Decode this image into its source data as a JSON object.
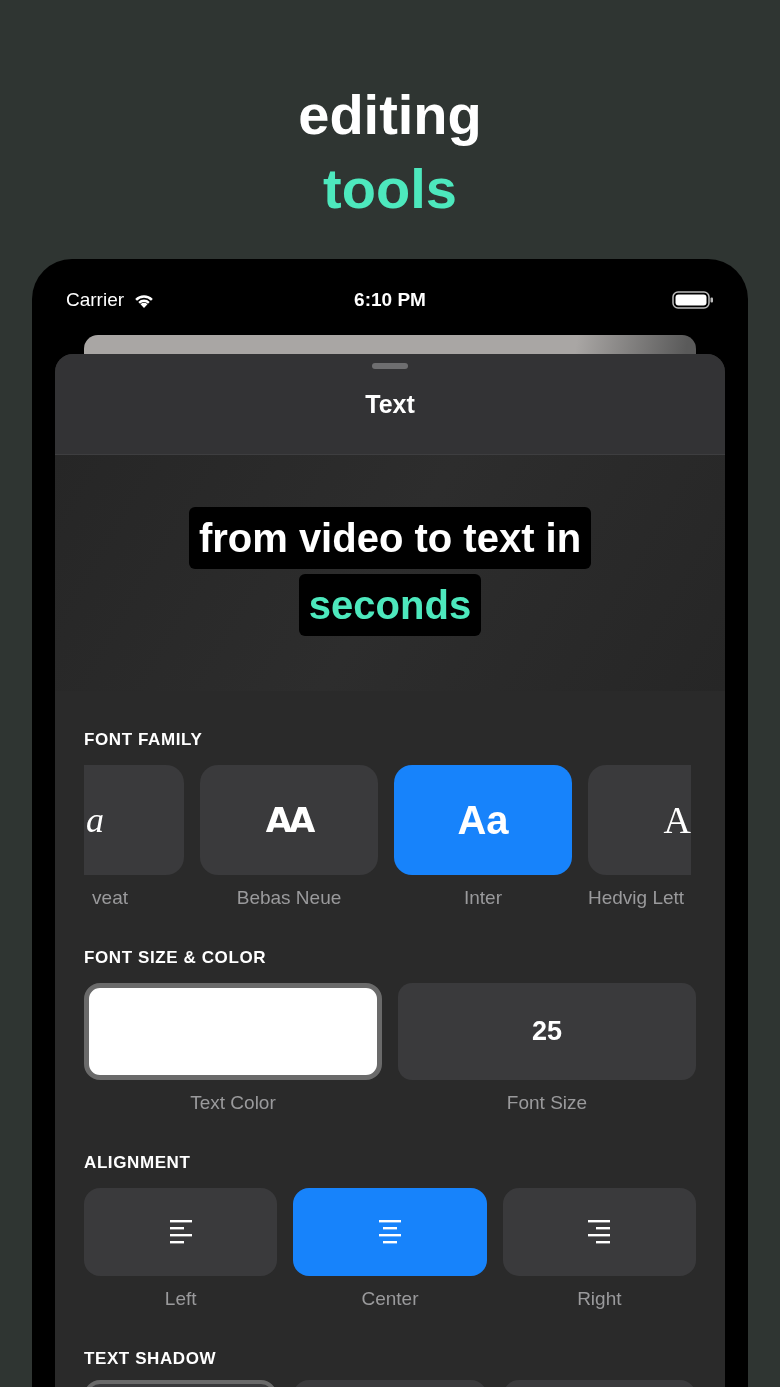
{
  "headline": {
    "line_1": "editing",
    "line_2": "tools"
  },
  "status_bar": {
    "carrier": "Carrier",
    "time": "6:10 PM"
  },
  "sheet": {
    "title": "Text"
  },
  "preview": {
    "lines": [
      {
        "text": "from video to text in",
        "highlighted": false
      },
      {
        "text": "seconds",
        "highlighted": true
      }
    ]
  },
  "font_family": {
    "label": "FONT FAMILY",
    "fonts": [
      {
        "sample": "a",
        "name": "veat",
        "kind": "script",
        "clipped_left": true,
        "clipped_right": false,
        "selected": false
      },
      {
        "sample": "AA",
        "name": "Bebas Neue",
        "kind": "display",
        "clipped_left": false,
        "clipped_right": false,
        "selected": false
      },
      {
        "sample": "Aa",
        "name": "Inter",
        "kind": "sans",
        "clipped_left": false,
        "clipped_right": false,
        "selected": true
      },
      {
        "sample": "A",
        "name": "Hedvig Lett",
        "kind": "serif",
        "clipped_left": false,
        "clipped_right": true,
        "selected": false
      }
    ]
  },
  "font_size_color": {
    "label": "FONT SIZE & COLOR",
    "text_color": {
      "color": "#ffffff",
      "caption": "Text Color",
      "selected": true
    },
    "font_size": {
      "value": "25",
      "caption": "Font Size"
    }
  },
  "alignment": {
    "label": "ALIGNMENT",
    "options": [
      {
        "kind": "left",
        "caption": "Left",
        "selected": false
      },
      {
        "kind": "center",
        "caption": "Center",
        "selected": true
      },
      {
        "kind": "right",
        "caption": "Right",
        "selected": false
      }
    ]
  },
  "text_shadow": {
    "label": "TEXT SHADOW",
    "options": [
      {
        "selected": true
      },
      {
        "selected": false
      },
      {
        "selected": false
      }
    ]
  }
}
